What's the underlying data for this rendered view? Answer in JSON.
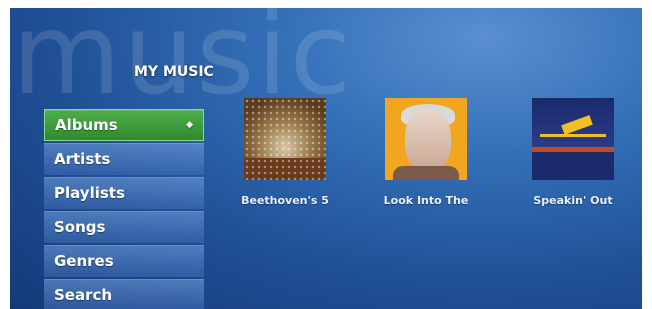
{
  "watermark": "music",
  "section_title": "MY MUSIC",
  "menu": [
    {
      "label": "Albums",
      "selected": true
    },
    {
      "label": "Artists",
      "selected": false
    },
    {
      "label": "Playlists",
      "selected": false
    },
    {
      "label": "Songs",
      "selected": false
    },
    {
      "label": "Genres",
      "selected": false
    },
    {
      "label": "Search",
      "selected": false
    }
  ],
  "albums": [
    {
      "title": "Beethoven's 5"
    },
    {
      "title": "Look Into The"
    },
    {
      "title": "Speakin' Out"
    }
  ],
  "colors": {
    "accent_selected": "#3a9a3a",
    "background": "#2a5fa8"
  }
}
